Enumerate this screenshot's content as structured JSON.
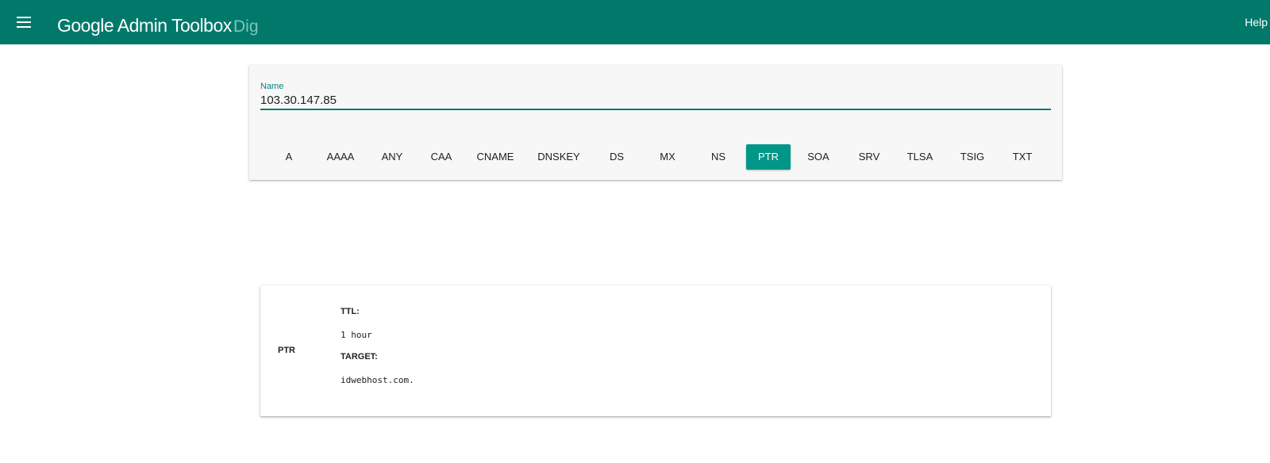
{
  "header": {
    "title": "Google Admin Toolbox",
    "subtitle": "Dig",
    "help_label": "Help",
    "menu_icon": "menu-icon",
    "background_color": "#00796b"
  },
  "query": {
    "name_label": "Name",
    "name_value": "103.30.147.85",
    "record_types": [
      "A",
      "AAAA",
      "ANY",
      "CAA",
      "CNAME",
      "DNSKEY",
      "DS",
      "MX",
      "NS",
      "PTR",
      "SOA",
      "SRV",
      "TLSA",
      "TSIG",
      "TXT"
    ],
    "selected_type": "PTR",
    "accent_color": "#009688"
  },
  "result": {
    "record_type": "PTR",
    "fields": [
      {
        "label": "TTL:",
        "value": "1 hour"
      },
      {
        "label": "TARGET:",
        "value": "idwebhost.com."
      }
    ]
  }
}
